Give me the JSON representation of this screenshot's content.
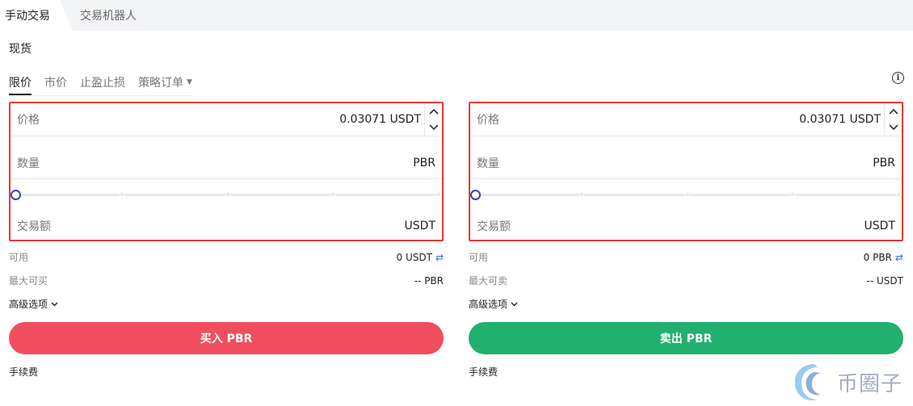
{
  "top_tabs": {
    "manual": "手动交易",
    "bot": "交易机器人"
  },
  "section_title": "现货",
  "order_types": [
    {
      "label": "限价",
      "active": true
    },
    {
      "label": "市价",
      "active": false
    },
    {
      "label": "止盈止损",
      "active": false
    },
    {
      "label": "策略订单",
      "active": false,
      "dropdown": true
    }
  ],
  "buy": {
    "price_label": "价格",
    "price_value": "0.03071 USDT",
    "qty_label": "数量",
    "qty_unit": "PBR",
    "slider_percent": 0,
    "amount_label": "交易额",
    "amount_unit": "USDT",
    "available_label": "可用",
    "available_value": "0 USDT",
    "max_label": "最大可买",
    "max_value": "-- PBR",
    "advanced_label": "高级选项",
    "button_label": "买入 PBR",
    "fee_label": "手续费"
  },
  "sell": {
    "price_label": "价格",
    "price_value": "0.03071 USDT",
    "qty_label": "数量",
    "qty_unit": "PBR",
    "slider_percent": 0,
    "amount_label": "交易额",
    "amount_unit": "USDT",
    "available_label": "可用",
    "available_value": "0 PBR",
    "max_label": "最大可卖",
    "max_value": "-- USDT",
    "advanced_label": "高级选项",
    "button_label": "卖出 PBR",
    "fee_label": "手续费"
  },
  "watermark_text": "币圈子",
  "colors": {
    "buy": "#f04e5e",
    "sell": "#22b06e",
    "highlight": "#e53935",
    "knob": "#3548a8",
    "swap": "#3b6bd6"
  },
  "icons": {
    "info": "info-circle-icon",
    "swap": "swap-arrows-icon",
    "chevron": "chevron-down-icon"
  }
}
